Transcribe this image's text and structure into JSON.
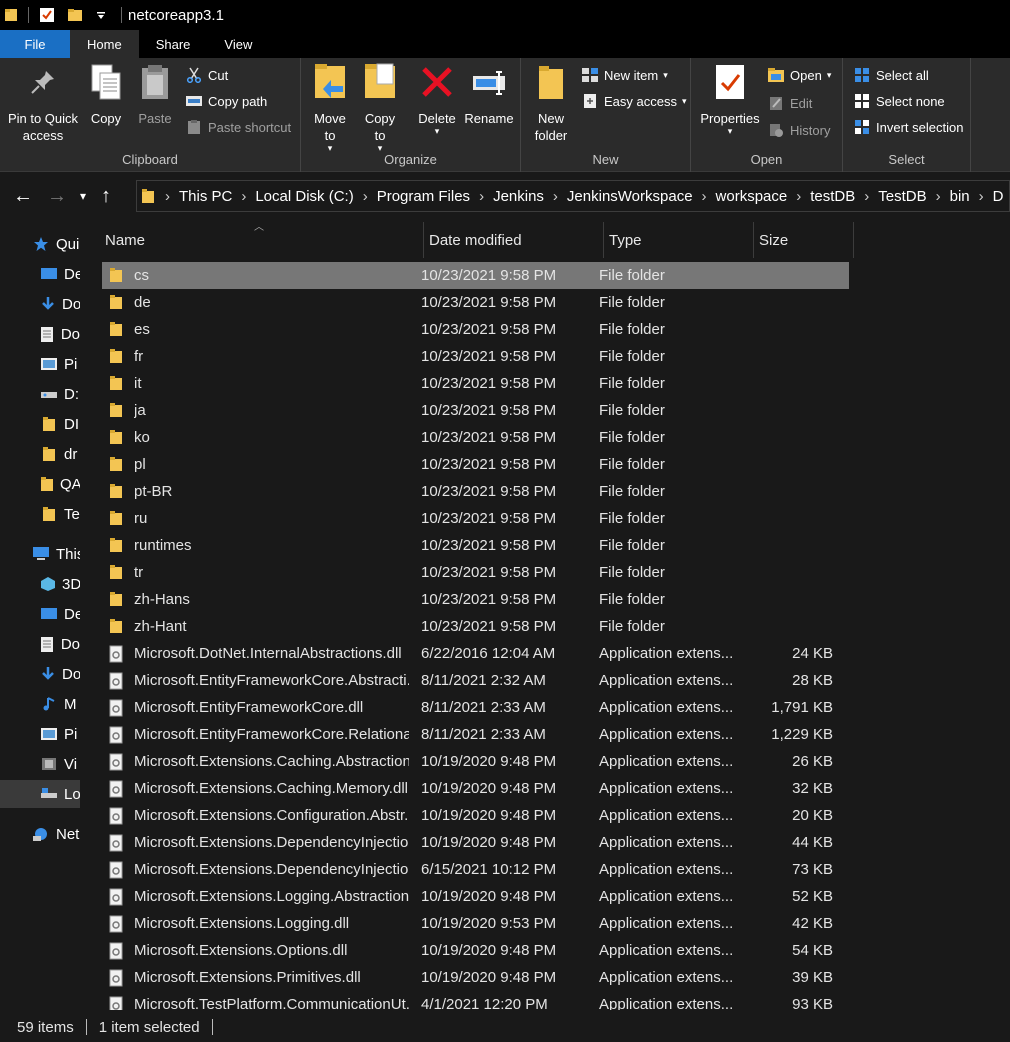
{
  "window": {
    "title": "netcoreapp3.1"
  },
  "tabs": [
    {
      "label": "File"
    },
    {
      "label": "Home"
    },
    {
      "label": "Share"
    },
    {
      "label": "View"
    }
  ],
  "ribbon": {
    "clipboard": {
      "label": "Clipboard",
      "pin": "Pin to Quick access",
      "copy": "Copy",
      "paste": "Paste",
      "cut": "Cut",
      "copy_path": "Copy path",
      "paste_shortcut": "Paste shortcut"
    },
    "organize": {
      "label": "Organize",
      "move_to": "Move to",
      "copy_to": "Copy to",
      "delete": "Delete",
      "rename": "Rename"
    },
    "new": {
      "label": "New",
      "new_folder": "New folder",
      "new_item": "New item",
      "easy_access": "Easy access"
    },
    "open": {
      "label": "Open",
      "properties": "Properties",
      "open": "Open",
      "edit": "Edit",
      "history": "History"
    },
    "select": {
      "label": "Select",
      "select_all": "Select all",
      "select_none": "Select none",
      "invert": "Invert selection"
    }
  },
  "breadcrumb": [
    "This PC",
    "Local Disk (C:)",
    "Program Files",
    "Jenkins",
    "JenkinsWorkspace",
    "workspace",
    "testDB",
    "TestDB",
    "bin",
    "D"
  ],
  "sidebar": [
    {
      "label": "Qui",
      "icon": "star-icon"
    },
    {
      "label": "De",
      "icon": "desktop-icon"
    },
    {
      "label": "Do",
      "icon": "download-icon"
    },
    {
      "label": "Do",
      "icon": "document-icon"
    },
    {
      "label": "Pi",
      "icon": "pictures-icon"
    },
    {
      "label": "D:",
      "icon": "drive-icon"
    },
    {
      "label": "DI",
      "icon": "folder-icon"
    },
    {
      "label": "dr",
      "icon": "folder-icon"
    },
    {
      "label": "QA",
      "icon": "folder-icon"
    },
    {
      "label": "Te",
      "icon": "folder-icon"
    },
    {
      "label": "This",
      "icon": "this-pc-icon"
    },
    {
      "label": "3D",
      "icon": "3d-objects-icon"
    },
    {
      "label": "De",
      "icon": "desktop-icon"
    },
    {
      "label": "Do",
      "icon": "document-icon"
    },
    {
      "label": "Do",
      "icon": "download-icon"
    },
    {
      "label": "M",
      "icon": "music-icon"
    },
    {
      "label": "Pi",
      "icon": "pictures-icon"
    },
    {
      "label": "Vi",
      "icon": "videos-icon"
    },
    {
      "label": "Lo",
      "icon": "local-disk-icon"
    },
    {
      "label": "Net",
      "icon": "network-icon"
    }
  ],
  "columns": {
    "name": "Name",
    "date": "Date modified",
    "type": "Type",
    "size": "Size"
  },
  "files": [
    {
      "name": "cs",
      "date": "10/23/2021 9:58 PM",
      "type": "File folder",
      "size": "",
      "kind": "folder",
      "selected": true
    },
    {
      "name": "de",
      "date": "10/23/2021 9:58 PM",
      "type": "File folder",
      "size": "",
      "kind": "folder"
    },
    {
      "name": "es",
      "date": "10/23/2021 9:58 PM",
      "type": "File folder",
      "size": "",
      "kind": "folder"
    },
    {
      "name": "fr",
      "date": "10/23/2021 9:58 PM",
      "type": "File folder",
      "size": "",
      "kind": "folder"
    },
    {
      "name": "it",
      "date": "10/23/2021 9:58 PM",
      "type": "File folder",
      "size": "",
      "kind": "folder"
    },
    {
      "name": "ja",
      "date": "10/23/2021 9:58 PM",
      "type": "File folder",
      "size": "",
      "kind": "folder"
    },
    {
      "name": "ko",
      "date": "10/23/2021 9:58 PM",
      "type": "File folder",
      "size": "",
      "kind": "folder"
    },
    {
      "name": "pl",
      "date": "10/23/2021 9:58 PM",
      "type": "File folder",
      "size": "",
      "kind": "folder"
    },
    {
      "name": "pt-BR",
      "date": "10/23/2021 9:58 PM",
      "type": "File folder",
      "size": "",
      "kind": "folder"
    },
    {
      "name": "ru",
      "date": "10/23/2021 9:58 PM",
      "type": "File folder",
      "size": "",
      "kind": "folder"
    },
    {
      "name": "runtimes",
      "date": "10/23/2021 9:58 PM",
      "type": "File folder",
      "size": "",
      "kind": "folder"
    },
    {
      "name": "tr",
      "date": "10/23/2021 9:58 PM",
      "type": "File folder",
      "size": "",
      "kind": "folder"
    },
    {
      "name": "zh-Hans",
      "date": "10/23/2021 9:58 PM",
      "type": "File folder",
      "size": "",
      "kind": "folder"
    },
    {
      "name": "zh-Hant",
      "date": "10/23/2021 9:58 PM",
      "type": "File folder",
      "size": "",
      "kind": "folder"
    },
    {
      "name": "Microsoft.DotNet.InternalAbstractions.dll",
      "date": "6/22/2016 12:04 AM",
      "type": "Application extens...",
      "size": "24 KB",
      "kind": "dll"
    },
    {
      "name": "Microsoft.EntityFrameworkCore.Abstracti...",
      "date": "8/11/2021 2:32 AM",
      "type": "Application extens...",
      "size": "28 KB",
      "kind": "dll"
    },
    {
      "name": "Microsoft.EntityFrameworkCore.dll",
      "date": "8/11/2021 2:33 AM",
      "type": "Application extens...",
      "size": "1,791 KB",
      "kind": "dll"
    },
    {
      "name": "Microsoft.EntityFrameworkCore.Relationa...",
      "date": "8/11/2021 2:33 AM",
      "type": "Application extens...",
      "size": "1,229 KB",
      "kind": "dll"
    },
    {
      "name": "Microsoft.Extensions.Caching.Abstraction...",
      "date": "10/19/2020 9:48 PM",
      "type": "Application extens...",
      "size": "26 KB",
      "kind": "dll"
    },
    {
      "name": "Microsoft.Extensions.Caching.Memory.dll",
      "date": "10/19/2020 9:48 PM",
      "type": "Application extens...",
      "size": "32 KB",
      "kind": "dll"
    },
    {
      "name": "Microsoft.Extensions.Configuration.Abstr...",
      "date": "10/19/2020 9:48 PM",
      "type": "Application extens...",
      "size": "20 KB",
      "kind": "dll"
    },
    {
      "name": "Microsoft.Extensions.DependencyInjectio...",
      "date": "10/19/2020 9:48 PM",
      "type": "Application extens...",
      "size": "44 KB",
      "kind": "dll"
    },
    {
      "name": "Microsoft.Extensions.DependencyInjectio...",
      "date": "6/15/2021 10:12 PM",
      "type": "Application extens...",
      "size": "73 KB",
      "kind": "dll"
    },
    {
      "name": "Microsoft.Extensions.Logging.Abstraction...",
      "date": "10/19/2020 9:48 PM",
      "type": "Application extens...",
      "size": "52 KB",
      "kind": "dll"
    },
    {
      "name": "Microsoft.Extensions.Logging.dll",
      "date": "10/19/2020 9:53 PM",
      "type": "Application extens...",
      "size": "42 KB",
      "kind": "dll"
    },
    {
      "name": "Microsoft.Extensions.Options.dll",
      "date": "10/19/2020 9:48 PM",
      "type": "Application extens...",
      "size": "54 KB",
      "kind": "dll"
    },
    {
      "name": "Microsoft.Extensions.Primitives.dll",
      "date": "10/19/2020 9:48 PM",
      "type": "Application extens...",
      "size": "39 KB",
      "kind": "dll"
    },
    {
      "name": "Microsoft.TestPlatform.CommunicationUt...",
      "date": "4/1/2021 12:20 PM",
      "type": "Application extens...",
      "size": "93 KB",
      "kind": "dll"
    }
  ],
  "status": {
    "items": "59 items",
    "selected": "1 item selected"
  },
  "colors": {
    "accent": "#1a6fc4",
    "folder": "#f3c553",
    "delete": "#e81123",
    "background": "#191919",
    "ribbon": "#2b2b2b"
  }
}
